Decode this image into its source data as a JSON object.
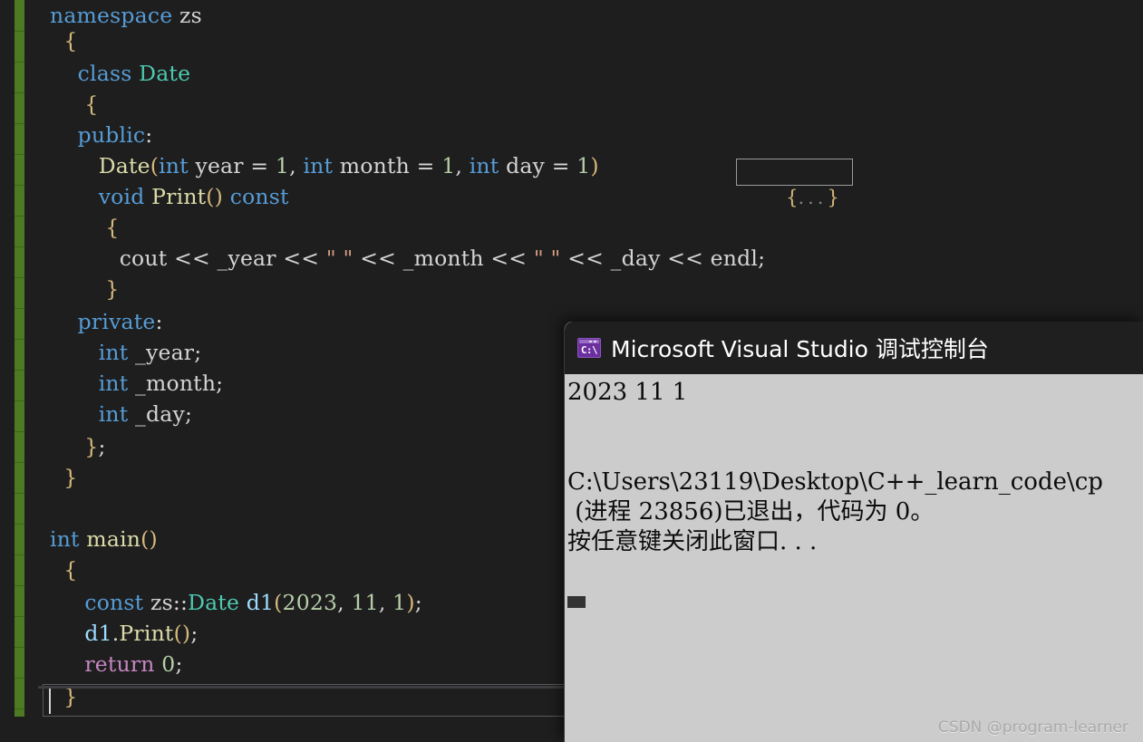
{
  "editor": {
    "name": "visual-studio-code-editor",
    "background": "#1e1e1e",
    "change_bar_color": "#4d7a22",
    "lines": [
      {
        "indent": 0,
        "text": "namespace zs"
      },
      {
        "indent": 1,
        "text": "{"
      },
      {
        "indent": 2,
        "text": "class Date"
      },
      {
        "indent": 2,
        "text": "{"
      },
      {
        "indent": 2,
        "text": "public:"
      },
      {
        "indent": 3,
        "text": "Date(int year = 1, int month = 1, int day = 1)"
      },
      {
        "indent": 3,
        "text": "void Print() const"
      },
      {
        "indent": 3,
        "text": "{"
      },
      {
        "indent": 4,
        "text": "cout << _year << \" \" << _month << \" \" << _day << endl;"
      },
      {
        "indent": 3,
        "text": "}"
      },
      {
        "indent": 2,
        "text": "private:"
      },
      {
        "indent": 3,
        "text": "int _year;"
      },
      {
        "indent": 3,
        "text": "int _month;"
      },
      {
        "indent": 3,
        "text": "int _day;"
      },
      {
        "indent": 2,
        "text": "};"
      },
      {
        "indent": 1,
        "text": "}"
      },
      {
        "indent": 0,
        "text": ""
      },
      {
        "indent": 0,
        "text": "int main()"
      },
      {
        "indent": 1,
        "text": "{"
      },
      {
        "indent": 2,
        "text": "const zs::Date d1(2023, 11, 1);"
      },
      {
        "indent": 2,
        "text": "d1.Print();"
      },
      {
        "indent": 2,
        "text": "return 0;"
      },
      {
        "indent": 1,
        "text": "}"
      }
    ],
    "collapsed_block": {
      "open_brace": "{",
      "dots": "...",
      "close_brace": "}"
    },
    "fold_markers": [
      {
        "line": 0,
        "state": "expanded",
        "symbol": "-"
      },
      {
        "line": 2,
        "state": "expanded",
        "symbol": "-"
      },
      {
        "line": 5,
        "state": "collapsed",
        "symbol": "+"
      },
      {
        "line": 6,
        "state": "expanded",
        "symbol": "-"
      },
      {
        "line": 17,
        "state": "expanded",
        "symbol": "-"
      }
    ],
    "syntax_colors": {
      "keyword": "#569cd6",
      "type": "#4ec9b0",
      "function": "#dcdcaa",
      "variable": "#9cdcfe",
      "number": "#b5cea8",
      "string": "#d69d85",
      "control": "#c586c0",
      "plain": "#d4d4d4",
      "brace": "#d7ba7d"
    }
  },
  "console": {
    "name": "debug-console-window",
    "icon": "console-app-icon",
    "icon_glyph": "C:\\",
    "title": "Microsoft Visual Studio 调试控制台",
    "titlebar_color": "#1f1f1f",
    "body_color": "#cccccc",
    "output_lines": [
      "2023 11 1",
      "",
      "",
      "C:\\Users\\23119\\Desktop\\C++_learn_code\\cp",
      " (进程 23856)已退出，代码为 0。",
      "按任意键关闭此窗口. . ."
    ]
  },
  "watermark": {
    "text": "CSDN @program-learner"
  }
}
